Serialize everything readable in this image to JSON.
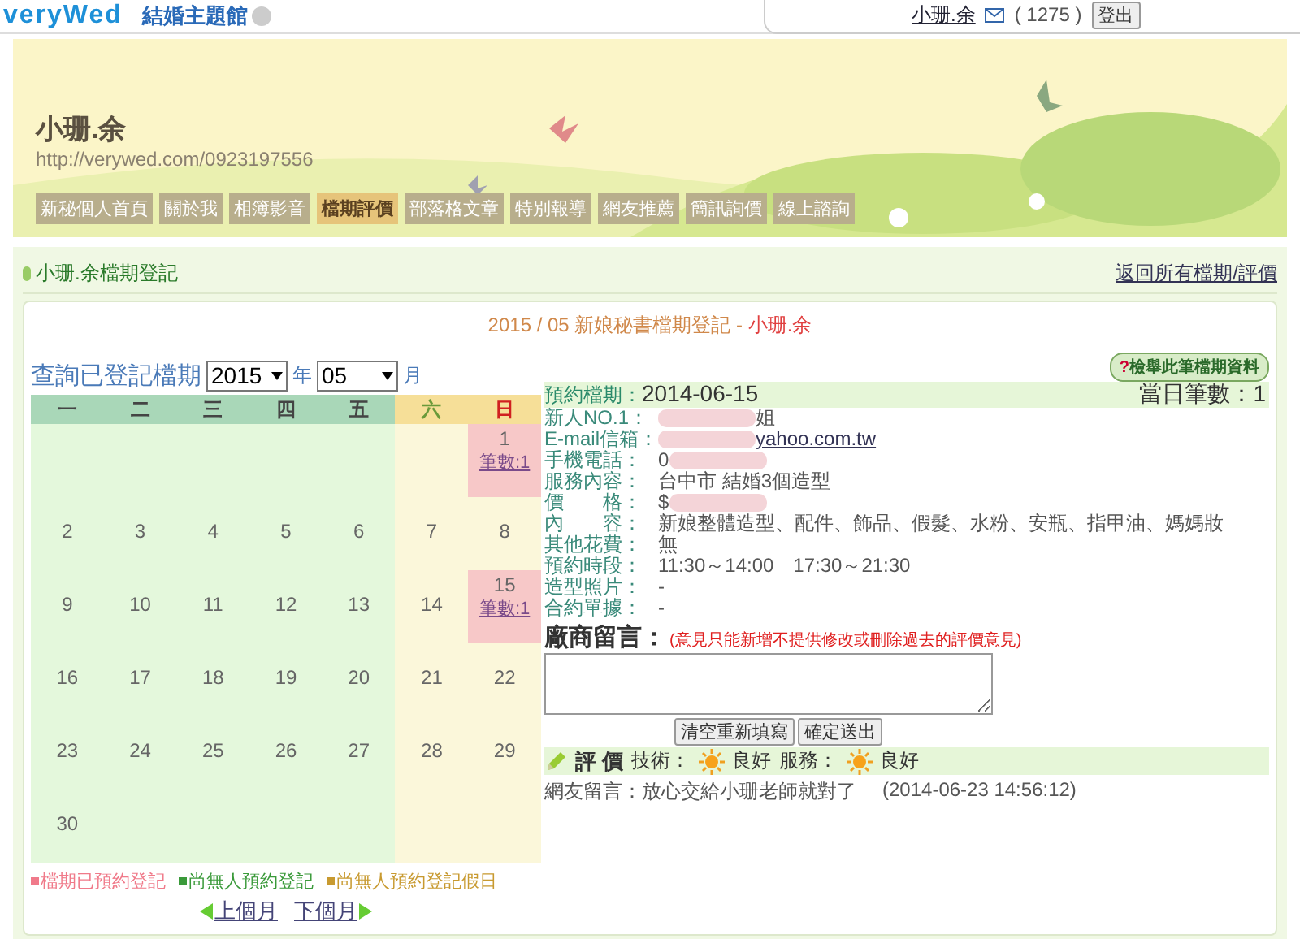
{
  "topbar": {
    "logo": "veryWed",
    "section": "結婚主題館",
    "user": "小珊.余",
    "count": "( 1275 )",
    "logout": "登出"
  },
  "banner": {
    "name": "小珊.余",
    "url": "http://verywed.com/0923197556",
    "nav": [
      {
        "label": "新秘個人首頁",
        "selected": false
      },
      {
        "label": "關於我",
        "selected": false
      },
      {
        "label": "相簿影音",
        "selected": false
      },
      {
        "label": "檔期評價",
        "selected": true
      },
      {
        "label": "部落格文章",
        "selected": false
      },
      {
        "label": "特別報導",
        "selected": false
      },
      {
        "label": "網友推薦",
        "selected": false
      },
      {
        "label": "簡訊詢價",
        "selected": false
      },
      {
        "label": "線上諮詢",
        "selected": false
      }
    ]
  },
  "section": {
    "title": "小珊.余檔期登記",
    "back_link": "返回所有檔期/評價"
  },
  "heading": {
    "text": "2015 / 05 新娘秘書檔期登記 - ",
    "name": "小珊.余"
  },
  "query": {
    "label": "查詢已登記檔期",
    "year": "2015",
    "year_unit": "年",
    "month": "05",
    "month_unit": "月"
  },
  "calendar": {
    "weekdays": [
      {
        "label": "一",
        "kind": "weekday"
      },
      {
        "label": "二",
        "kind": "weekday"
      },
      {
        "label": "三",
        "kind": "weekday"
      },
      {
        "label": "四",
        "kind": "weekday"
      },
      {
        "label": "五",
        "kind": "weekday"
      },
      {
        "label": "六",
        "kind": "saturday"
      },
      {
        "label": "日",
        "kind": "sunday"
      }
    ],
    "weeks": [
      [
        {
          "kind": "empty"
        },
        {
          "kind": "empty"
        },
        {
          "kind": "empty"
        },
        {
          "kind": "empty"
        },
        {
          "kind": "empty"
        },
        {
          "kind": "empty"
        },
        {
          "kind": "day",
          "day": "1",
          "booked": true,
          "count": "筆數:1"
        }
      ],
      [
        {
          "day": "2",
          "booked": false
        },
        {
          "day": "3",
          "booked": false
        },
        {
          "day": "4",
          "booked": false
        },
        {
          "day": "5",
          "booked": false
        },
        {
          "day": "6",
          "booked": false
        },
        {
          "day": "7",
          "booked": false
        },
        {
          "day": "8",
          "booked": false
        }
      ],
      [
        {
          "day": "9",
          "booked": false
        },
        {
          "day": "10",
          "booked": false
        },
        {
          "day": "11",
          "booked": false
        },
        {
          "day": "12",
          "booked": false
        },
        {
          "day": "13",
          "booked": false
        },
        {
          "day": "14",
          "booked": false
        },
        {
          "day": "15",
          "booked": true,
          "count": "筆數:1"
        }
      ],
      [
        {
          "day": "16",
          "booked": false
        },
        {
          "day": "17",
          "booked": false
        },
        {
          "day": "18",
          "booked": false
        },
        {
          "day": "19",
          "booked": false
        },
        {
          "day": "20",
          "booked": false
        },
        {
          "day": "21",
          "booked": false
        },
        {
          "day": "22",
          "booked": false
        }
      ],
      [
        {
          "day": "23",
          "booked": false
        },
        {
          "day": "24",
          "booked": false
        },
        {
          "day": "25",
          "booked": false
        },
        {
          "day": "26",
          "booked": false
        },
        {
          "day": "27",
          "booked": false
        },
        {
          "day": "28",
          "booked": false
        },
        {
          "day": "29",
          "booked": false
        }
      ],
      [
        {
          "day": "30",
          "booked": false
        },
        {
          "kind": "empty"
        },
        {
          "kind": "empty"
        },
        {
          "kind": "empty"
        },
        {
          "kind": "empty"
        },
        {
          "kind": "empty"
        },
        {
          "kind": "empty"
        }
      ]
    ],
    "legend": [
      {
        "label": "檔期已預約登記",
        "color": "#f07a8a"
      },
      {
        "label": "尚無人預約登記",
        "color": "#3a9a3a"
      },
      {
        "label": "尚無人預約登記假日",
        "color": "#c89a30"
      }
    ],
    "prev": "上個月",
    "next": "下個月"
  },
  "detail": {
    "report_mark": "?",
    "report_button": "檢舉此筆檔期資料",
    "date_label": "預約檔期：",
    "date": "2014-06-15",
    "count_label": "當日筆數：",
    "count": "1",
    "fields": [
      {
        "label": "新人NO.1：",
        "parts": [
          {
            "kind": "redacted"
          },
          {
            "kind": "text",
            "text": "姐"
          }
        ]
      },
      {
        "label": "E-mail信箱：",
        "parts": [
          {
            "kind": "redacted"
          },
          {
            "kind": "link",
            "text": "yahoo.com.tw"
          }
        ]
      },
      {
        "label": "手機電話：",
        "parts": [
          {
            "kind": "text",
            "text": "0"
          },
          {
            "kind": "redacted"
          }
        ]
      },
      {
        "label": "服務內容：",
        "parts": [
          {
            "kind": "text",
            "text": "台中市 結婚3個造型"
          }
        ]
      },
      {
        "label": "價　　格：",
        "parts": [
          {
            "kind": "text",
            "text": "$"
          },
          {
            "kind": "redacted"
          }
        ]
      },
      {
        "label": "內　　容：",
        "parts": [
          {
            "kind": "text",
            "text": "新娘整體造型、配件、飾品、假髮、水粉、安瓶、指甲油、媽媽妝"
          }
        ]
      },
      {
        "label": "其他花費：",
        "parts": [
          {
            "kind": "text",
            "text": "無"
          }
        ]
      },
      {
        "label": "預約時段：",
        "parts": [
          {
            "kind": "text",
            "text": "11:30～14:00　17:30～21:30"
          }
        ]
      },
      {
        "label": "造型照片：",
        "parts": [
          {
            "kind": "text",
            "text": "-"
          }
        ]
      },
      {
        "label": "合約單據：",
        "parts": [
          {
            "kind": "text",
            "text": "-"
          }
        ]
      }
    ],
    "message_label": "廠商留言：",
    "message_note": "(意見只能新增不提供修改或刪除過去的評價意見)",
    "clear_button": "清空重新填寫",
    "submit_button": "確定送出",
    "rating_title": "評 價",
    "ratings": [
      {
        "label": "技術：",
        "value": "良好"
      },
      {
        "label": "服務：",
        "value": "良好"
      }
    ],
    "comment": "網友留言：放心交給小珊老師就對了",
    "comment_time": "(2014-06-23 14:56:12)"
  }
}
